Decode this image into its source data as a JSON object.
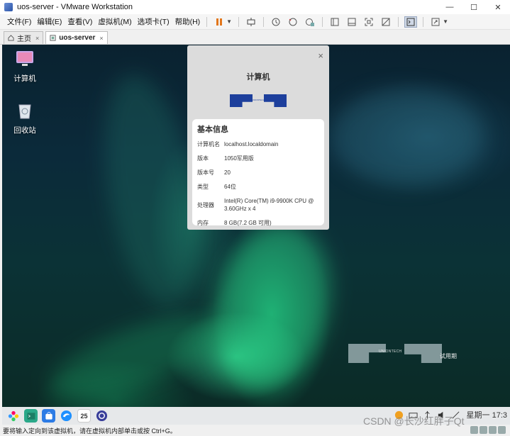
{
  "window": {
    "title": "uos-server - VMware Workstation",
    "controls": [
      "—",
      "☐",
      "✕"
    ]
  },
  "menu": [
    "文件(F)",
    "编辑(E)",
    "查看(V)",
    "虚拟机(M)",
    "选项卡(T)",
    "帮助(H)"
  ],
  "tabs": [
    {
      "label": "主页",
      "icon": "home-icon"
    },
    {
      "label": "uos-server",
      "icon": "vm-icon",
      "close": "×"
    }
  ],
  "desktop": {
    "icons": [
      {
        "label": "计算机",
        "icon": "computer-icon"
      },
      {
        "label": "回收站",
        "icon": "trash-icon"
      }
    ],
    "watermark": {
      "brand": "UNIONTECH",
      "trial": "试用期"
    }
  },
  "dialog": {
    "close": "×",
    "title": "计算机",
    "logo_text": "UNIONTECH",
    "section": "基本信息",
    "rows": [
      {
        "key": "计算机名",
        "value": "localhost.localdomain"
      },
      {
        "key": "版本",
        "value": "1050军用版"
      },
      {
        "key": "版本号",
        "value": "20"
      },
      {
        "key": "类型",
        "value": "64位"
      },
      {
        "key": "处理器",
        "value": "Intel(R) Core(TM) i9-9900K CPU @ 3.60GHz x 4"
      },
      {
        "key": "内存",
        "value": "8 GB(7.2 GB 可用)"
      }
    ]
  },
  "taskbar": {
    "apps": [
      "launcher-icon",
      "terminal-icon",
      "app-store-icon",
      "browser-icon",
      "calendar-icon",
      "settings-icon"
    ],
    "calendar_day": "25",
    "tray_text": "星期一 17:3"
  },
  "status": {
    "message": "要将输入定向到该虚拟机，请在虚拟机内部单击或按 Ctrl+G。"
  },
  "overlay_text": "CSDN @长沙红胖子Qt",
  "colors": {
    "accent": "#1d3f9c",
    "pause": "#e2761b",
    "desktop_dark": "#0b2a3a",
    "aurora": "#2fe89a"
  }
}
